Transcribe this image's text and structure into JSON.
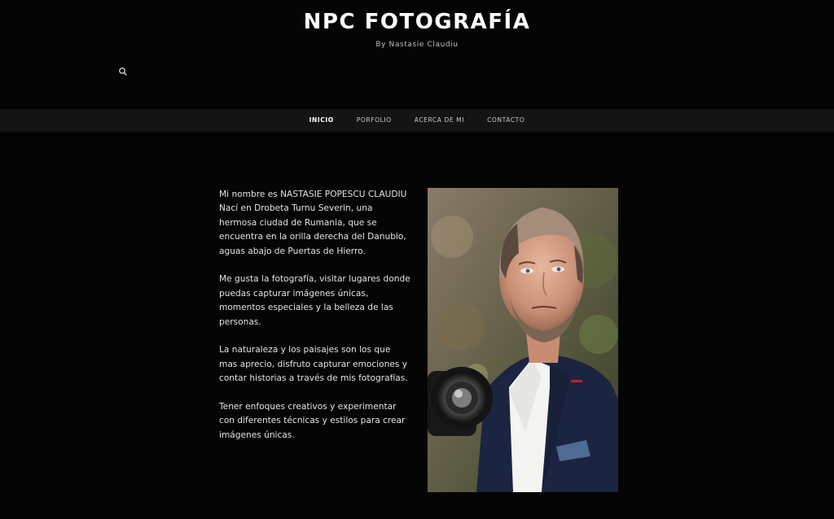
{
  "header": {
    "title": "NPC FOTOGRAFÍA",
    "tagline": "By Nastasie Claudiu",
    "search_icon": "search-icon"
  },
  "nav": {
    "items": [
      {
        "label": "INICIO",
        "active": true
      },
      {
        "label": "PORFOLIO",
        "active": false
      },
      {
        "label": "ACERCA DE MI",
        "active": false
      },
      {
        "label": "CONTACTO",
        "active": false
      }
    ]
  },
  "main": {
    "paragraphs": [
      "Mi nombre es NASTASIE POPESCU CLAUDIU Nací en Drobeta Turnu Severin, una hermosa ciudad de Rumania, que se encuentra en la orilla derecha del Danubio, aguas abajo de Puertas de Hierro.",
      "Me gusta la fotografía, visitar lugares donde puedas capturar imágenes únicas, momentos especiales y la belleza de las personas.",
      "La naturaleza y los paisajes son los que mas aprecio, disfruto capturar emociones y contar historias a través de mis fotografías.",
      "Tener enfoques creativos y experimentar con diferentes técnicas y estilos para crear imágenes únicas."
    ]
  },
  "colors": {
    "background": "#050505",
    "nav_background": "#141414",
    "text": "#e2e2e2",
    "accent": "#ffffff"
  }
}
